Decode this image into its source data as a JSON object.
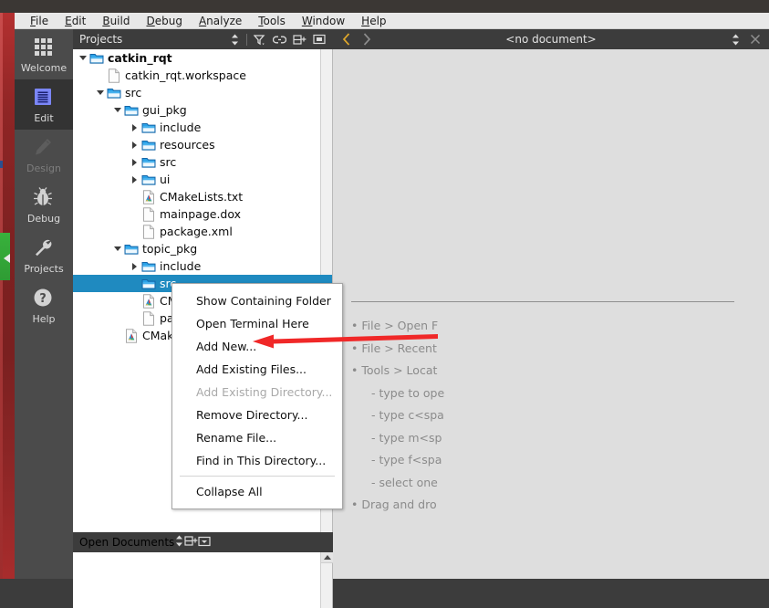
{
  "window": {
    "frame_color": "#8e2525",
    "accent_green": "#38b13c"
  },
  "menubar": {
    "items": [
      {
        "label": "File",
        "mnemonic": "F"
      },
      {
        "label": "Edit",
        "mnemonic": "E"
      },
      {
        "label": "Build",
        "mnemonic": "B"
      },
      {
        "label": "Debug",
        "mnemonic": "D"
      },
      {
        "label": "Analyze",
        "mnemonic": "A"
      },
      {
        "label": "Tools",
        "mnemonic": "T"
      },
      {
        "label": "Window",
        "mnemonic": "W"
      },
      {
        "label": "Help",
        "mnemonic": "H"
      }
    ]
  },
  "modebar": {
    "items": [
      {
        "label": "Welcome",
        "icon": "grid-icon",
        "state": "normal"
      },
      {
        "label": "Edit",
        "icon": "document-lines-icon",
        "state": "active"
      },
      {
        "label": "Design",
        "icon": "pencil-icon",
        "state": "disabled"
      },
      {
        "label": "Debug",
        "icon": "bug-icon",
        "state": "normal"
      },
      {
        "label": "Projects",
        "icon": "wrench-icon",
        "state": "normal"
      },
      {
        "label": "Help",
        "icon": "question-circle-icon",
        "state": "normal"
      }
    ]
  },
  "projects_panel": {
    "title": "Projects",
    "toolbar": [
      {
        "name": "sync-selection-icon",
        "glyph": "updown"
      },
      {
        "name": "filter-icon",
        "glyph": "filter"
      },
      {
        "name": "link-icon",
        "glyph": "link"
      },
      {
        "name": "split-icon",
        "glyph": "splitplus"
      },
      {
        "name": "close-panel-icon",
        "glyph": "minimize"
      }
    ],
    "tree": [
      {
        "label": "catkin_rqt",
        "depth": 0,
        "icon": "folder-open-icon",
        "expander": "down",
        "bold": true,
        "selected": false
      },
      {
        "label": "catkin_rqt.workspace",
        "depth": 1,
        "icon": "file-icon",
        "expander": "none",
        "bold": false,
        "selected": false
      },
      {
        "label": "src",
        "depth": 1,
        "icon": "folder-open-icon",
        "expander": "down",
        "bold": false,
        "selected": false
      },
      {
        "label": "gui_pkg",
        "depth": 2,
        "icon": "folder-open-icon",
        "expander": "down",
        "bold": false,
        "selected": false
      },
      {
        "label": "include",
        "depth": 3,
        "icon": "folder-icon",
        "expander": "right",
        "bold": false,
        "selected": false
      },
      {
        "label": "resources",
        "depth": 3,
        "icon": "folder-icon",
        "expander": "right",
        "bold": false,
        "selected": false
      },
      {
        "label": "src",
        "depth": 3,
        "icon": "folder-icon",
        "expander": "right",
        "bold": false,
        "selected": false
      },
      {
        "label": "ui",
        "depth": 3,
        "icon": "folder-icon",
        "expander": "right",
        "bold": false,
        "selected": false
      },
      {
        "label": "CMakeLists.txt",
        "depth": 3,
        "icon": "cmake-file-icon",
        "expander": "none",
        "bold": false,
        "selected": false
      },
      {
        "label": "mainpage.dox",
        "depth": 3,
        "icon": "file-icon",
        "expander": "none",
        "bold": false,
        "selected": false
      },
      {
        "label": "package.xml",
        "depth": 3,
        "icon": "file-icon",
        "expander": "none",
        "bold": false,
        "selected": false
      },
      {
        "label": "topic_pkg",
        "depth": 2,
        "icon": "folder-open-icon",
        "expander": "down",
        "bold": false,
        "selected": false
      },
      {
        "label": "include",
        "depth": 3,
        "icon": "folder-icon",
        "expander": "right",
        "bold": false,
        "selected": false
      },
      {
        "label": "src",
        "depth": 3,
        "icon": "folder-icon",
        "expander": "none",
        "bold": false,
        "selected": true
      },
      {
        "label": "CMakeLists.txt",
        "depth": 3,
        "icon": "cmake-file-icon",
        "expander": "none",
        "bold": false,
        "selected": false
      },
      {
        "label": "package.xml",
        "depth": 3,
        "icon": "file-icon",
        "expander": "none",
        "bold": false,
        "selected": false
      },
      {
        "label": "CMakeLists.txt",
        "depth": 2,
        "icon": "cmake-file-icon",
        "expander": "none",
        "bold": false,
        "selected": false
      }
    ]
  },
  "open_documents_panel": {
    "title": "Open Documents",
    "toolbar": [
      {
        "name": "sync-selection-icon",
        "glyph": "updown"
      },
      {
        "name": "split-icon",
        "glyph": "splitplus"
      },
      {
        "name": "close-panel-icon",
        "glyph": "minimize"
      }
    ],
    "items": []
  },
  "editor": {
    "document_title": "<no document>",
    "nav_back": "back-arrow-icon",
    "nav_forward": "forward-arrow-icon",
    "dropdown": "document-dropdown-icon",
    "close": "close-document-icon",
    "tips": [
      {
        "text": "• File > Open F",
        "indent": false
      },
      {
        "text": "• File > Recent",
        "indent": false
      },
      {
        "text": "• Tools > Locat",
        "indent": false
      },
      {
        "text": "- type to ope",
        "indent": true
      },
      {
        "text": "- type c<spa",
        "indent": true
      },
      {
        "text": "- type m<sp",
        "indent": true
      },
      {
        "text": "- type f<spa",
        "indent": true
      },
      {
        "text": "- select one",
        "indent": true
      },
      {
        "text": "• Drag and dro",
        "indent": false
      }
    ]
  },
  "context_menu": {
    "items": [
      {
        "label": "Show Containing Folder",
        "disabled": false,
        "separator_after": false
      },
      {
        "label": "Open Terminal Here",
        "disabled": false,
        "separator_after": false
      },
      {
        "label": "Add New...",
        "disabled": false,
        "separator_after": false
      },
      {
        "label": "Add Existing Files...",
        "disabled": false,
        "separator_after": false
      },
      {
        "label": "Add Existing Directory...",
        "disabled": true,
        "separator_after": false
      },
      {
        "label": "Remove Directory...",
        "disabled": false,
        "separator_after": false
      },
      {
        "label": "Rename File...",
        "disabled": false,
        "separator_after": false
      },
      {
        "label": "Find in This Directory...",
        "disabled": false,
        "separator_after": true
      },
      {
        "label": "Collapse All",
        "disabled": false,
        "separator_after": false
      }
    ]
  },
  "annotation": {
    "arrow_color": "#f02828",
    "points_at": "Add New..."
  }
}
